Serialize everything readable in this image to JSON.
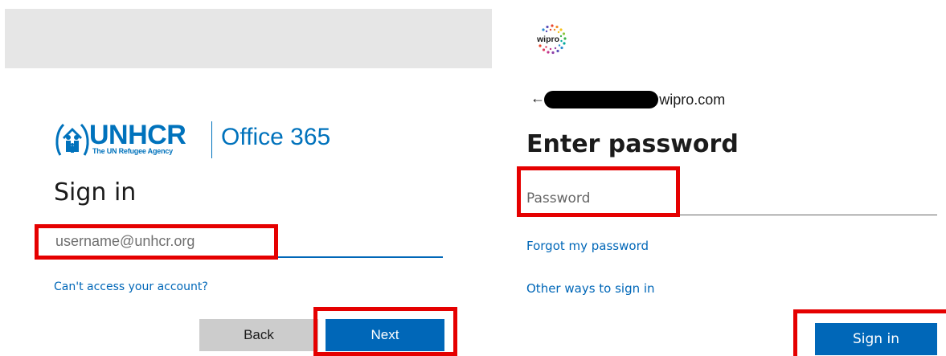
{
  "left_panel": {
    "logo": {
      "org_name": "UNHCR",
      "tagline": "The UN Refugee Agency",
      "product": "Office 365"
    },
    "title": "Sign in",
    "username_placeholder": "username@unhcr.org",
    "cant_access_link": "Can't access your account?",
    "back_button": "Back",
    "next_button": "Next"
  },
  "right_panel": {
    "logo_text": "wipro",
    "back_arrow": "←",
    "email_suffix": "@wipro.com",
    "title": "Enter password",
    "password_placeholder": "Password",
    "forgot_link": "Forgot my password",
    "other_ways_link": "Other ways to sign in",
    "signin_button": "Sign in"
  },
  "colors": {
    "accent": "#0067b8",
    "unhcr_blue": "#0072bc",
    "highlight_red": "#e50000",
    "redaction": "#000000"
  }
}
